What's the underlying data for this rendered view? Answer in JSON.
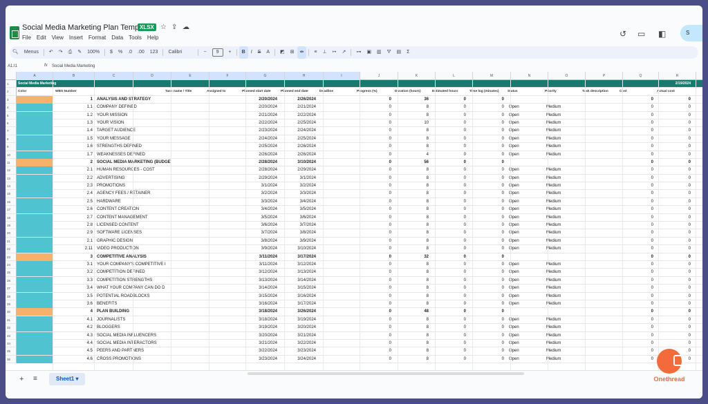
{
  "app": {
    "doc_title": "Social Media Marketing Plan Template",
    "file_badge": "XLSX",
    "share_label": "S"
  },
  "menu": [
    "File",
    "Edit",
    "View",
    "Insert",
    "Format",
    "Data",
    "Tools",
    "Help"
  ],
  "toolbar": {
    "menus_label": "Menus",
    "zoom": "100%",
    "currency": "$",
    "percent": "%",
    "decimals_dec": ".0",
    "decimals_inc": ".00",
    "number_format": "123",
    "font": "Calibri",
    "font_size": "9",
    "bold": "B",
    "italic": "I",
    "text_color": "A",
    "sum": "Σ"
  },
  "formula": {
    "cell": "A1:I1",
    "fx": "fx",
    "value": "Social Media Marketing"
  },
  "columns": [
    "A",
    "B",
    "C",
    "D",
    "E",
    "F",
    "G",
    "H",
    "I",
    "J",
    "K",
    "L",
    "M",
    "N",
    "O",
    "P",
    "Q",
    "R"
  ],
  "banner": {
    "title": "Social Media Marketing",
    "date": "2/19/2024"
  },
  "headers": {
    "color": "Color",
    "wbs": "WBS Number",
    "name": "Task name / Title",
    "assigned": "Assigned to",
    "start": "Planned start date",
    "end": "Planned end date",
    "deadline": "Deadline",
    "progress": "Progress (%)",
    "duration": "Duration (hours)",
    "estimated": "Estimated hours",
    "timelog": "Time log (minutes)",
    "status": "Status",
    "priority": "Priority",
    "description": "Task description",
    "cost": "Cost",
    "actual": "Actual cost"
  },
  "rows": [
    {
      "section": true,
      "wbs": "1",
      "name": "ANALYSIS AND STRATEGY",
      "start": "2/20/2024",
      "end": "2/26/2024",
      "prog": "0",
      "dur": "36",
      "est": "0",
      "log": "0",
      "status": "",
      "prio": "",
      "cost": "0",
      "act": "0"
    },
    {
      "wbs": "1.1",
      "name": "COMPANY DEFINED",
      "start": "2/20/2024",
      "end": "2/21/2024",
      "prog": "0",
      "dur": "8",
      "est": "0",
      "log": "0",
      "status": "Open",
      "prio": "Medium",
      "cost": "0",
      "act": "0"
    },
    {
      "wbs": "1.2",
      "name": "YOUR MISSION",
      "start": "2/21/2024",
      "end": "2/22/2024",
      "prog": "0",
      "dur": "8",
      "est": "0",
      "log": "0",
      "status": "Open",
      "prio": "Medium",
      "cost": "0",
      "act": "0"
    },
    {
      "wbs": "1.3",
      "name": "YOUR VISION",
      "start": "2/22/2024",
      "end": "2/25/2024",
      "prog": "0",
      "dur": "10",
      "est": "0",
      "log": "0",
      "status": "Open",
      "prio": "Medium",
      "cost": "0",
      "act": "0"
    },
    {
      "wbs": "1.4",
      "name": "TARGET AUDIENCE",
      "start": "2/23/2024",
      "end": "2/24/2024",
      "prog": "0",
      "dur": "8",
      "est": "0",
      "log": "0",
      "status": "Open",
      "prio": "Medium",
      "cost": "0",
      "act": "0"
    },
    {
      "wbs": "1.5",
      "name": "YOUR MESSAGE",
      "start": "2/24/2024",
      "end": "2/25/2024",
      "prog": "0",
      "dur": "8",
      "est": "0",
      "log": "0",
      "status": "Open",
      "prio": "Medium",
      "cost": "0",
      "act": "0"
    },
    {
      "wbs": "1.6",
      "name": "STRENGTHS DEFINED",
      "start": "2/25/2024",
      "end": "2/26/2024",
      "prog": "0",
      "dur": "8",
      "est": "0",
      "log": "0",
      "status": "Open",
      "prio": "Medium",
      "cost": "0",
      "act": "0"
    },
    {
      "wbs": "1.7",
      "name": "WEAKNESSES DEFINED",
      "start": "2/26/2024",
      "end": "2/26/2024",
      "prog": "0",
      "dur": "4",
      "est": "0",
      "log": "0",
      "status": "Open",
      "prio": "Medium",
      "cost": "0",
      "act": "0"
    },
    {
      "section": true,
      "wbs": "2",
      "name": "SOCIAL MEDIA MARKETING (BUDGET)",
      "start": "2/28/2024",
      "end": "3/10/2024",
      "prog": "0",
      "dur": "56",
      "est": "0",
      "log": "0",
      "status": "",
      "prio": "",
      "cost": "0",
      "act": "0"
    },
    {
      "wbs": "2.1",
      "name": "HUMAN RESOURCES - COST",
      "start": "2/28/2024",
      "end": "2/29/2024",
      "prog": "0",
      "dur": "8",
      "est": "0",
      "log": "0",
      "status": "Open",
      "prio": "Medium",
      "cost": "0",
      "act": "0"
    },
    {
      "wbs": "2.2",
      "name": "ADVERTISING",
      "start": "2/29/2024",
      "end": "3/1/2024",
      "prog": "0",
      "dur": "8",
      "est": "0",
      "log": "0",
      "status": "Open",
      "prio": "Medium",
      "cost": "0",
      "act": "0"
    },
    {
      "wbs": "2.3",
      "name": "PROMOTIONS",
      "start": "3/1/2024",
      "end": "3/2/2024",
      "prog": "0",
      "dur": "8",
      "est": "0",
      "log": "0",
      "status": "Open",
      "prio": "Medium",
      "cost": "0",
      "act": "0"
    },
    {
      "wbs": "2.4",
      "name": "AGENCY FEES / RETAINER",
      "start": "3/2/2024",
      "end": "3/3/2024",
      "prog": "0",
      "dur": "8",
      "est": "0",
      "log": "0",
      "status": "Open",
      "prio": "Medium",
      "cost": "0",
      "act": "0"
    },
    {
      "wbs": "2.5",
      "name": "HARDWARE",
      "start": "3/3/2024",
      "end": "3/4/2024",
      "prog": "0",
      "dur": "8",
      "est": "0",
      "log": "0",
      "status": "Open",
      "prio": "Medium",
      "cost": "0",
      "act": "0"
    },
    {
      "wbs": "2.6",
      "name": "CONTENT CREATION",
      "start": "3/4/2024",
      "end": "3/5/2024",
      "prog": "0",
      "dur": "8",
      "est": "0",
      "log": "0",
      "status": "Open",
      "prio": "Medium",
      "cost": "0",
      "act": "0"
    },
    {
      "wbs": "2.7",
      "name": "CONTENT MANAGEMENT",
      "start": "3/5/2024",
      "end": "3/6/2024",
      "prog": "0",
      "dur": "8",
      "est": "0",
      "log": "0",
      "status": "Open",
      "prio": "Medium",
      "cost": "0",
      "act": "0"
    },
    {
      "wbs": "2.8",
      "name": "LICENSED CONTENT",
      "start": "3/6/2024",
      "end": "3/7/2024",
      "prog": "0",
      "dur": "8",
      "est": "0",
      "log": "0",
      "status": "Open",
      "prio": "Medium",
      "cost": "0",
      "act": "0"
    },
    {
      "wbs": "2.9",
      "name": "SOFTWARE LICENSES",
      "start": "3/7/2024",
      "end": "3/8/2024",
      "prog": "0",
      "dur": "8",
      "est": "0",
      "log": "0",
      "status": "Open",
      "prio": "Medium",
      "cost": "0",
      "act": "0"
    },
    {
      "wbs": "2.1",
      "name": "GRAPHIC DESIGN",
      "start": "3/8/2024",
      "end": "3/9/2024",
      "prog": "0",
      "dur": "8",
      "est": "0",
      "log": "0",
      "status": "Open",
      "prio": "Medium",
      "cost": "0",
      "act": "0"
    },
    {
      "wbs": "2.11",
      "name": "VIDEO PRODUCTION",
      "start": "3/9/2024",
      "end": "3/10/2024",
      "prog": "0",
      "dur": "8",
      "est": "0",
      "log": "0",
      "status": "Open",
      "prio": "Medium",
      "cost": "0",
      "act": "0"
    },
    {
      "section": true,
      "wbs": "3",
      "name": "COMPETITIVE ANALYSIS",
      "start": "3/11/2024",
      "end": "3/17/2024",
      "prog": "0",
      "dur": "32",
      "est": "0",
      "log": "0",
      "status": "",
      "prio": "",
      "cost": "0",
      "act": "0"
    },
    {
      "wbs": "3.1",
      "name": "YOUR COMPANY'S COMPETITIVE I",
      "start": "3/11/2024",
      "end": "3/12/2024",
      "prog": "0",
      "dur": "8",
      "est": "0",
      "log": "0",
      "status": "Open",
      "prio": "Medium",
      "cost": "0",
      "act": "0"
    },
    {
      "wbs": "3.2",
      "name": "COMPETITION DEFINED",
      "start": "3/12/2024",
      "end": "3/13/2024",
      "prog": "0",
      "dur": "8",
      "est": "0",
      "log": "0",
      "status": "Open",
      "prio": "Medium",
      "cost": "0",
      "act": "0"
    },
    {
      "wbs": "3.3",
      "name": "COMPETITION STRENGTHS",
      "start": "3/13/2024",
      "end": "3/14/2024",
      "prog": "0",
      "dur": "8",
      "est": "0",
      "log": "0",
      "status": "Open",
      "prio": "Medium",
      "cost": "0",
      "act": "0"
    },
    {
      "wbs": "3.4",
      "name": "WHAT YOUR COMPANY CAN DO D",
      "start": "3/14/2024",
      "end": "3/15/2024",
      "prog": "0",
      "dur": "8",
      "est": "0",
      "log": "0",
      "status": "Open",
      "prio": "Medium",
      "cost": "0",
      "act": "0"
    },
    {
      "wbs": "3.5",
      "name": "POTENTIAL ROADBLOCKS",
      "start": "3/15/2024",
      "end": "3/16/2024",
      "prog": "0",
      "dur": "8",
      "est": "0",
      "log": "0",
      "status": "Open",
      "prio": "Medium",
      "cost": "0",
      "act": "0"
    },
    {
      "wbs": "3.6",
      "name": "BENEFITS",
      "start": "3/16/2024",
      "end": "3/17/2024",
      "prog": "0",
      "dur": "8",
      "est": "0",
      "log": "0",
      "status": "Open",
      "prio": "Medium",
      "cost": "0",
      "act": "0"
    },
    {
      "section": true,
      "wbs": "4",
      "name": "PLAN BUILDING",
      "start": "3/18/2024",
      "end": "3/26/2024",
      "prog": "0",
      "dur": "48",
      "est": "0",
      "log": "0",
      "status": "",
      "prio": "",
      "cost": "0",
      "act": "0"
    },
    {
      "wbs": "4.1",
      "name": "JOURNALISTS",
      "start": "3/18/2024",
      "end": "3/19/2024",
      "prog": "0",
      "dur": "8",
      "est": "0",
      "log": "0",
      "status": "Open",
      "prio": "Medium",
      "cost": "0",
      "act": "0"
    },
    {
      "wbs": "4.2",
      "name": "BLOGGERS",
      "start": "3/19/2024",
      "end": "3/20/2024",
      "prog": "0",
      "dur": "8",
      "est": "0",
      "log": "0",
      "status": "Open",
      "prio": "Medium",
      "cost": "0",
      "act": "0"
    },
    {
      "wbs": "4.3",
      "name": "SOCIAL MEDIA INFLUENCERS",
      "start": "3/20/2024",
      "end": "3/21/2024",
      "prog": "0",
      "dur": "8",
      "est": "0",
      "log": "0",
      "status": "Open",
      "prio": "Medium",
      "cost": "0",
      "act": "0"
    },
    {
      "wbs": "4.4",
      "name": "SOCIAL MEDIA INTERACTORS",
      "start": "3/21/2024",
      "end": "3/22/2024",
      "prog": "0",
      "dur": "8",
      "est": "0",
      "log": "0",
      "status": "Open",
      "prio": "Medium",
      "cost": "0",
      "act": "0"
    },
    {
      "wbs": "4.5",
      "name": "PEERS AND PARTNERS",
      "start": "3/22/2024",
      "end": "3/23/2024",
      "prog": "0",
      "dur": "8",
      "est": "0",
      "log": "0",
      "status": "Open",
      "prio": "Medium",
      "cost": "0",
      "act": "0"
    },
    {
      "wbs": "4.6",
      "name": "CROSS PROMOTIONS",
      "start": "3/23/2024",
      "end": "3/24/2024",
      "prog": "0",
      "dur": "8",
      "est": "0",
      "log": "0",
      "status": "Open",
      "prio": "Medium",
      "cost": "0",
      "act": "0"
    }
  ],
  "colors": {
    "section_swatch": "#f6b26b",
    "task_swatch": "#4fc3cf",
    "banner": "#18796e"
  },
  "sheet_tab": "Sheet1",
  "watermark": "Onethread"
}
